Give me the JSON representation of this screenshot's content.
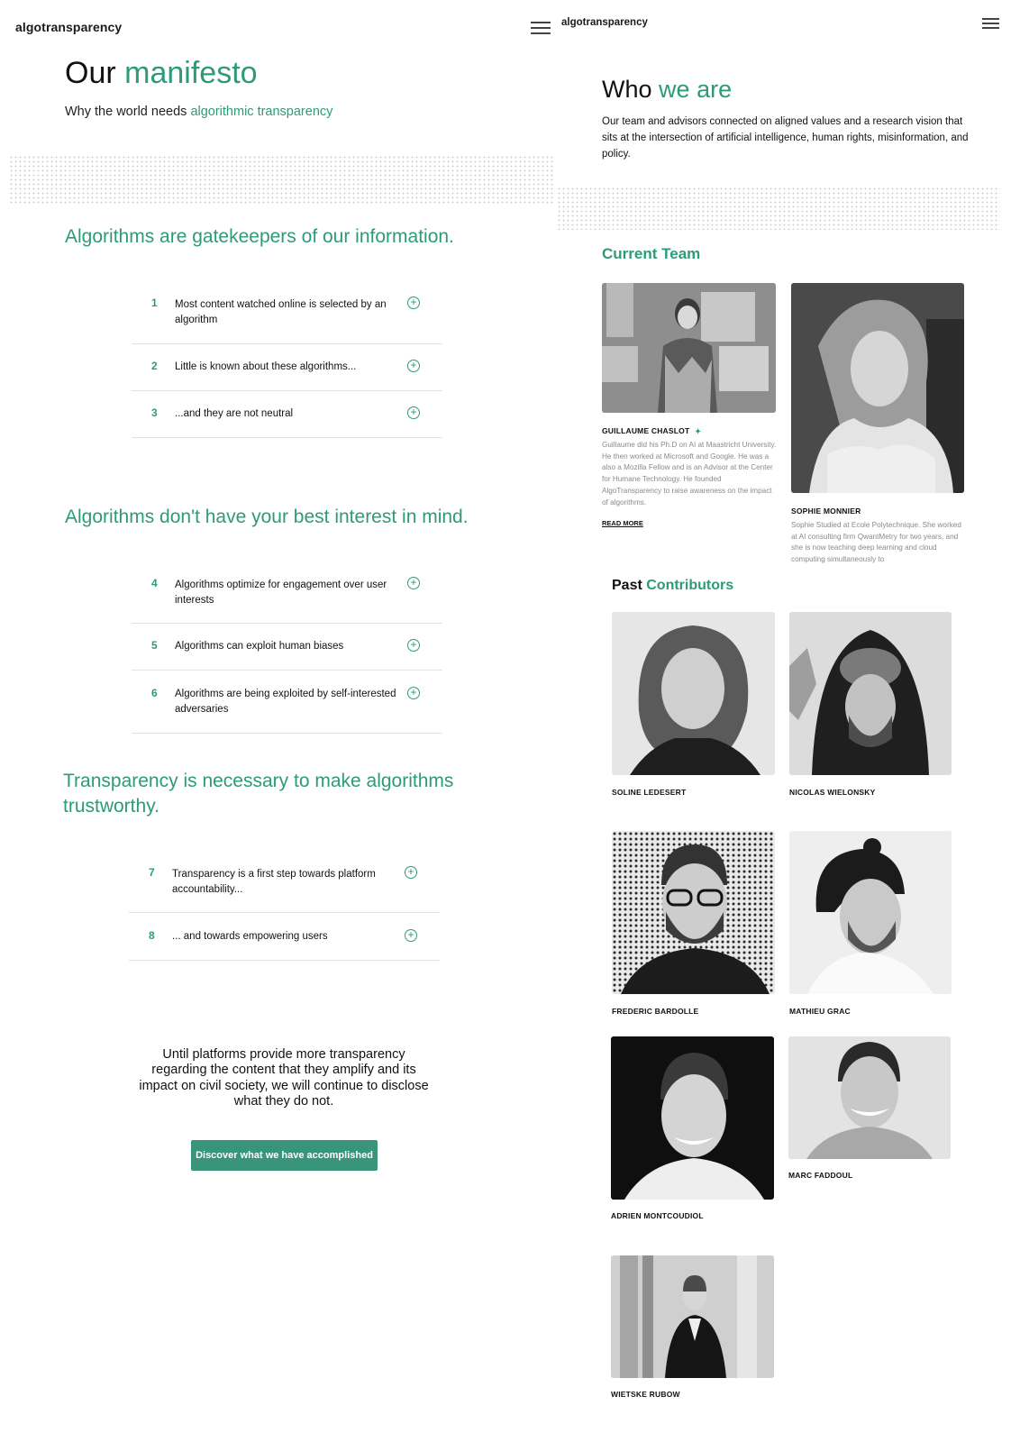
{
  "left": {
    "brand": "algotransparency",
    "title_plain": "Our",
    "title_accent": "manifesto",
    "subtitle_plain": "Why the world needs",
    "subtitle_accent": "algorithmic transparency",
    "sections": [
      {
        "title": "Algorithms are gatekeepers of our information.",
        "items": [
          {
            "num": "1",
            "text": "Most content watched online is selected by an algorithm"
          },
          {
            "num": "2",
            "text": "Little is known about these algorithms..."
          },
          {
            "num": "3",
            "text": "...and they are not neutral"
          }
        ]
      },
      {
        "title": "Algorithms don't have your best interest in mind.",
        "items": [
          {
            "num": "4",
            "text": "Algorithms optimize for engagement over user interests"
          },
          {
            "num": "5",
            "text": "Algorithms can exploit human biases"
          },
          {
            "num": "6",
            "text": "Algorithms are being exploited by self-interested adversaries"
          }
        ]
      },
      {
        "title": "Transparency is necessary to make algorithms trustworthy.",
        "items": [
          {
            "num": "7",
            "text": "Transparency is a first step towards platform accountability..."
          },
          {
            "num": "8",
            "text": "... and towards empowering users"
          }
        ]
      }
    ],
    "closing": "Until platforms provide more transparency regarding the content that they amplify and its impact on civil society, we will continue to disclose what they do not.",
    "cta_label": "Discover what we have accomplished",
    "plus_icon": "plus-circle-icon"
  },
  "right": {
    "brand": "algotransparency",
    "title_plain": "Who",
    "title_accent": "we are",
    "intro": "Our team and advisors connected on aligned values and a research vision that sits at the intersection of artificial intelligence, human rights, misinformation, and policy.",
    "current_team_title": "Current Team",
    "current_team": [
      {
        "name": "GUILLAUME CHASLOT",
        "bio": "Guillaume did his Ph.D on AI at Maastricht University. He then worked at Microsoft and Google. He was a also a Mozilla Fellow and is an Advisor at the Center for Humane Technology. He founded AlgoTransparency to raise awareness on the impact of algorithms.",
        "link": "READ MORE",
        "icon": "twitter-icon"
      },
      {
        "name": "SOPHIE MONNIER",
        "bio": "Sophie Studied at Ecole Polytechnique. She worked at AI consulting firm QwantMetry for two years, and she is now teaching deep learning and cloud computing simultaneously to"
      }
    ],
    "past_title_plain": "Past",
    "past_title_accent": "Contributors",
    "past": [
      "SOLINE LEDESERT",
      "NICOLAS WIELONSKY",
      "FREDERIC BARDOLLE",
      "MATHIEU GRAC",
      "ADRIEN MONTCOUDIOL",
      "MARC FADDOUL",
      "WIETSKE RUBOW"
    ]
  },
  "colors": {
    "accent": "#2e9a7a",
    "button": "#38947a",
    "divider": "#e2e2e2",
    "bio_text": "#8a8a8a"
  }
}
